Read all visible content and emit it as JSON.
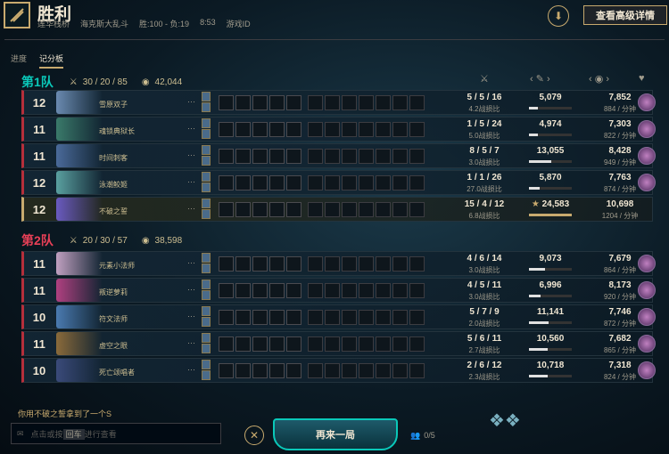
{
  "header": {
    "title": "胜利",
    "map": "莲华栈桥",
    "mode": "海克斯大乱斗",
    "record": "胜:100 - 负:19",
    "duration": "8:53",
    "game_id_label": "游戏ID",
    "advanced_button": "查看高级详情",
    "download_icon": "download-icon"
  },
  "tabs": [
    {
      "label": "进度",
      "active": false
    },
    {
      "label": "记分板",
      "active": true
    }
  ],
  "teams": [
    {
      "name": "第1队",
      "kda": "30 / 20 / 85",
      "gold": "42,044",
      "color": "#0ac8b9",
      "players": [
        {
          "level": "12",
          "name": "雪原双子",
          "kda": "5 / 5 / 16",
          "ratio": "4.2战损比",
          "damage": "5,079",
          "damage_pct": 0.21,
          "gold": "7,852",
          "gold_per_min": "884 / 分钟",
          "champ_color": "#6a8ab0"
        },
        {
          "level": "11",
          "name": "魂锁典狱长",
          "kda": "1 / 5 / 24",
          "ratio": "5.0战损比",
          "damage": "4,974",
          "damage_pct": 0.2,
          "gold": "7,303",
          "gold_per_min": "822 / 分钟",
          "champ_color": "#3a7a6a"
        },
        {
          "level": "11",
          "name": "时间刺客",
          "kda": "8 / 5 / 7",
          "ratio": "3.0战损比",
          "damage": "13,055",
          "damage_pct": 0.53,
          "gold": "8,428",
          "gold_per_min": "949 / 分钟",
          "champ_color": "#4a6a9a"
        },
        {
          "level": "12",
          "name": "泳潮鲛姬",
          "kda": "1 / 1 / 26",
          "ratio": "27.0战损比",
          "damage": "5,870",
          "damage_pct": 0.24,
          "gold": "7,763",
          "gold_per_min": "874 / 分钟",
          "champ_color": "#5aa0a0"
        },
        {
          "level": "12",
          "name": "不破之誓",
          "kda": "15 / 4 / 12",
          "ratio": "6.8战损比",
          "damage": "24,583",
          "damage_pct": 1.0,
          "gold": "10,698",
          "gold_per_min": "1204 / 分钟",
          "champ_color": "#6a5ac0",
          "me": true
        }
      ]
    },
    {
      "name": "第2队",
      "kda": "20 / 30 / 57",
      "gold": "38,598",
      "color": "#e84057",
      "players": [
        {
          "level": "11",
          "name": "元素小法师",
          "kda": "4 / 6 / 14",
          "ratio": "3.0战损比",
          "damage": "9,073",
          "damage_pct": 0.37,
          "gold": "7,679",
          "gold_per_min": "864 / 分钟",
          "champ_color": "#c0a0c0"
        },
        {
          "level": "11",
          "name": "叛逆萝莉",
          "kda": "4 / 5 / 11",
          "ratio": "3.0战损比",
          "damage": "6,996",
          "damage_pct": 0.28,
          "gold": "8,173",
          "gold_per_min": "920 / 分钟",
          "champ_color": "#b04080"
        },
        {
          "level": "10",
          "name": "符文法师",
          "kda": "5 / 7 / 9",
          "ratio": "2.0战损比",
          "damage": "11,141",
          "damage_pct": 0.45,
          "gold": "7,746",
          "gold_per_min": "872 / 分钟",
          "champ_color": "#4a7ab0"
        },
        {
          "level": "11",
          "name": "虚空之眼",
          "kda": "5 / 6 / 11",
          "ratio": "2.7战损比",
          "damage": "10,560",
          "damage_pct": 0.43,
          "gold": "7,682",
          "gold_per_min": "865 / 分钟",
          "champ_color": "#8a6a3a"
        },
        {
          "level": "10",
          "name": "死亡颂唱者",
          "kda": "2 / 6 / 12",
          "ratio": "2.3战损比",
          "damage": "10,718",
          "damage_pct": 0.44,
          "gold": "7,318",
          "gold_per_min": "824 / 分钟",
          "champ_color": "#3a4a7a"
        }
      ]
    }
  ],
  "footer": {
    "achievement": "你用不破之誓拿到了一个S",
    "chat_placeholder_pre": "点击或按",
    "chat_key": "回车",
    "chat_placeholder_post": "进行查看",
    "play_again": "再来一局",
    "party_count": "0/5"
  }
}
